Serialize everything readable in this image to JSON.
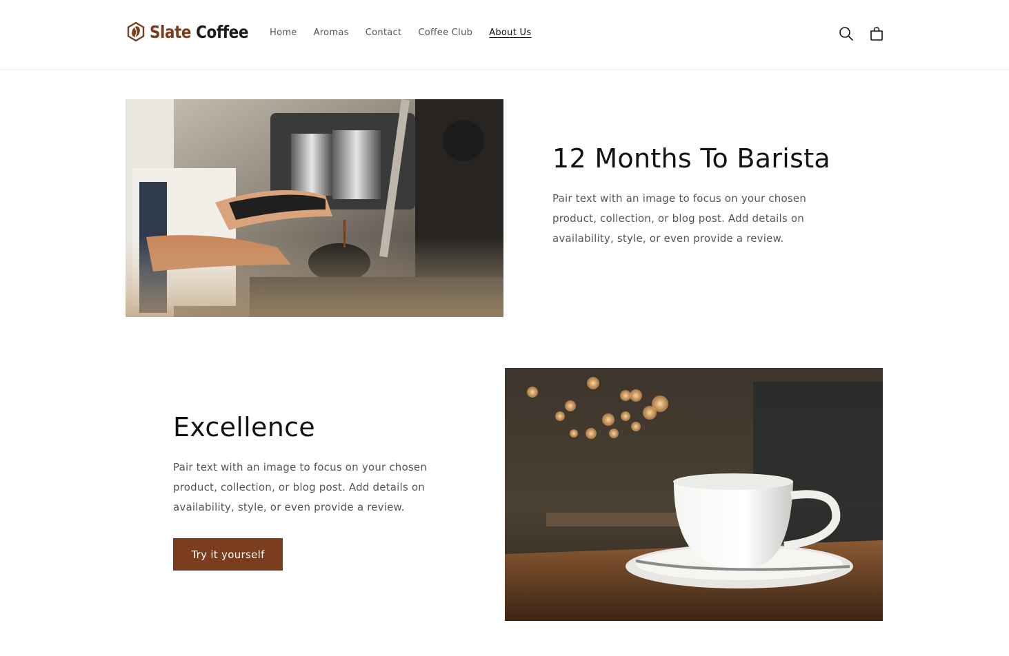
{
  "header": {
    "logo": {
      "word1": "Slate",
      "word2": "Coffee"
    },
    "nav": [
      {
        "label": "Home"
      },
      {
        "label": "Aromas"
      },
      {
        "label": "Contact"
      },
      {
        "label": "Coffee Club"
      },
      {
        "label": "About Us",
        "active": true
      }
    ],
    "icons": {
      "search": "search-icon",
      "cart": "cart-icon"
    }
  },
  "sections": [
    {
      "title": "12 Months To Barista",
      "body": "Pair text with an image to focus on your chosen product, collection, or blog post. Add details on availability, style, or even provide a review.",
      "image": "barista-espresso-machine-photo"
    },
    {
      "title": "Excellence",
      "body": "Pair text with an image to focus on your chosen product, collection, or blog post. Add details on availability, style, or even provide a review.",
      "button_label": "Try it yourself",
      "image": "coffee-cup-cafe-photo"
    }
  ],
  "colors": {
    "brand": "#7a3d1e",
    "text": "#121212",
    "muted": "#555555"
  }
}
